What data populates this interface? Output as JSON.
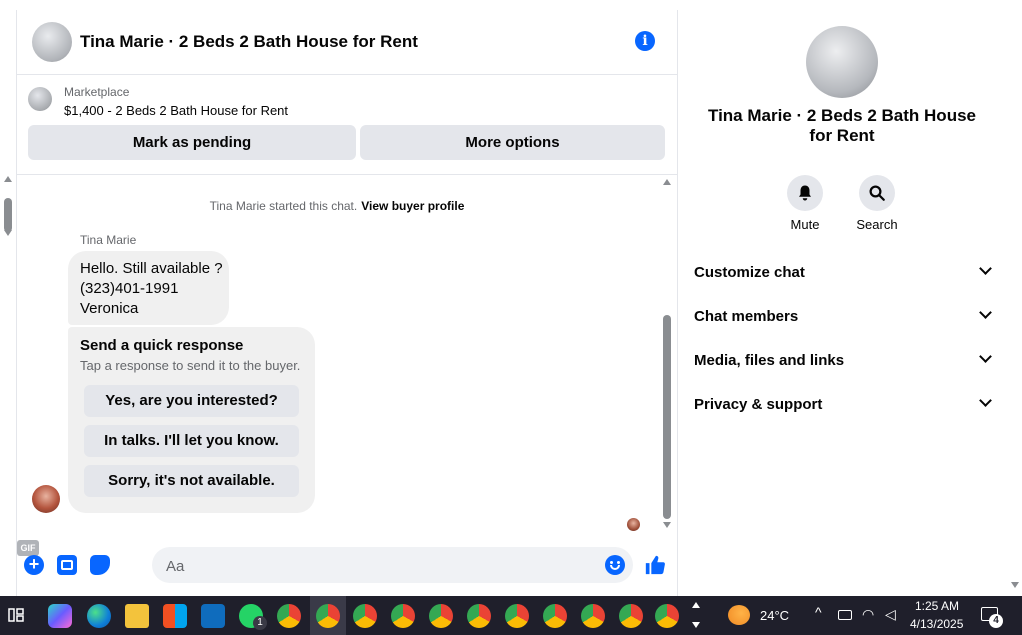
{
  "header": {
    "title": "Tina Marie · 2 Beds 2 Bath House for Rent"
  },
  "listing": {
    "source": "Marketplace",
    "title": "$1,400 - 2 Beds 2 Bath House for Rent",
    "mark_pending_label": "Mark as pending",
    "more_options_label": "More options"
  },
  "messages": {
    "system_text": "Tina Marie started this chat.",
    "system_link": "View buyer profile",
    "sender": "Tina Marie",
    "bubble_lines": [
      "Hello. Still available ?",
      "(323)401-1991",
      "Veronica"
    ],
    "quick_title": "Send a quick response",
    "quick_subtitle": "Tap a response to send it to the buyer.",
    "quick_options": [
      "Yes, are you interested?",
      "In talks. I'll let you know.",
      "Sorry, it's not available."
    ]
  },
  "composer": {
    "placeholder": "Aa",
    "gif_label": "GIF"
  },
  "panel": {
    "title": "Tina Marie · 2 Beds 2 Bath House for Rent",
    "actions": [
      {
        "label": "Mute",
        "icon": "bell-icon"
      },
      {
        "label": "Search",
        "icon": "search-icon"
      }
    ],
    "sections": [
      "Customize chat",
      "Chat members",
      "Media, files and links",
      "Privacy & support"
    ]
  },
  "taskbar": {
    "temperature": "24°C",
    "time": "1:25 AM",
    "date": "4/13/2025",
    "notification_count": "4",
    "whatsapp_badge": "1"
  },
  "colors": {
    "accent": "#0866ff",
    "bubble": "#f0f0f0",
    "button": "#e4e6eb",
    "taskbar": "#1f1f2b"
  }
}
